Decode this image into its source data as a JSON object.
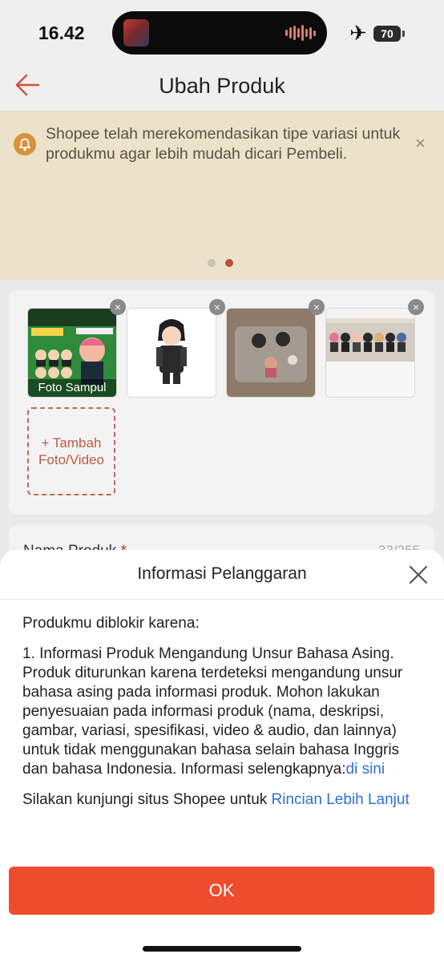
{
  "status_bar": {
    "time": "16.42",
    "battery": "70"
  },
  "header": {
    "title": "Ubah Produk"
  },
  "notice": {
    "text": "Shopee telah merekomendasikan tipe variasi untuk produkmu agar lebih mudah dicari Pembeli.",
    "close_symbol": "×"
  },
  "media": {
    "cover_label": "Foto Sampul",
    "add_label_line1": "+ Tambah",
    "add_label_line2": "Foto/Video",
    "remove_symbol": "×"
  },
  "product_name": {
    "label": "Nama Produk",
    "required_mark": "*",
    "counter": "33/255"
  },
  "dialog": {
    "title": "Informasi Pelanggaran",
    "intro": "Produkmu diblokir karena:",
    "reason": "1. Informasi Produk Mengandung Unsur Bahasa Asing. Produk diturunkan karena terdeteksi mengandung unsur bahasa asing pada informasi produk. Mohon lakukan penyesuaian pada informasi produk (nama, deskripsi, gambar, variasi, spesifikasi, video & audio, dan lainnya) untuk tidak menggunakan bahasa selain bahasa Inggris dan bahasa Indonesia. Informasi selengkapnya:",
    "reason_link": "di sini",
    "visit_text": "Silakan kunjungi situs Shopee untuk ",
    "visit_link": "Rincian Lebih Lanjut",
    "ok_label": "OK"
  },
  "colors": {
    "accent": "#ee4d2d",
    "link": "#2f6fd6",
    "notice_bg": "#ebe2c9"
  },
  "icons": [
    "back-arrow-icon",
    "bell-icon",
    "close-icon",
    "airplane-icon",
    "battery-icon"
  ]
}
